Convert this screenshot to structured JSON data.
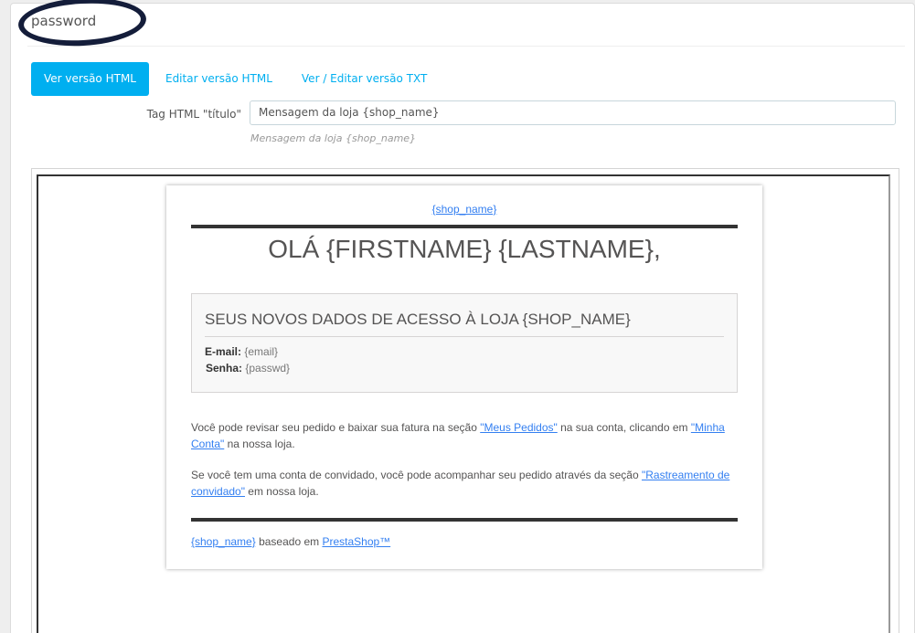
{
  "panel": {
    "title": "password"
  },
  "tabs": [
    {
      "label": "Ver versão HTML",
      "active": true
    },
    {
      "label": "Editar versão HTML",
      "active": false
    },
    {
      "label": "Ver / Editar versão TXT",
      "active": false
    }
  ],
  "title_field": {
    "label": "Tag HTML \"título\"",
    "value": "Mensagem da loja {shop_name}",
    "help": "Mensagem da loja {shop_name}"
  },
  "email": {
    "shop_link": "{shop_name}",
    "greeting": "OLÁ {FIRSTNAME} {LASTNAME},",
    "box_title": "SEUS NOVOS DADOS DE ACESSO À LOJA {SHOP_NAME}",
    "email_label": "E-mail:",
    "email_value": "{email}",
    "password_label": "Senha:",
    "password_value": "{passwd}",
    "para1_text1": "Você pode revisar seu pedido e baixar sua fatura na seção ",
    "para1_link1": "\"Meus Pedidos\"",
    "para1_text2": " na sua conta, clicando em ",
    "para1_link2": "\"Minha Conta\"",
    "para1_text3": " na nossa loja.",
    "para2_text1": "Se você tem uma conta de convidado, você pode acompanhar seu pedido através da seção ",
    "para2_link": "\"Rastreamento de convidado\"",
    "para2_text2": " em nossa loja.",
    "footer_link1": "{shop_name}",
    "footer_text": " baseado em ",
    "footer_link2": "PrestaShop™"
  },
  "colors": {
    "accent": "#00aff0",
    "link": "#337ff1",
    "scribble": "#141d3a"
  }
}
